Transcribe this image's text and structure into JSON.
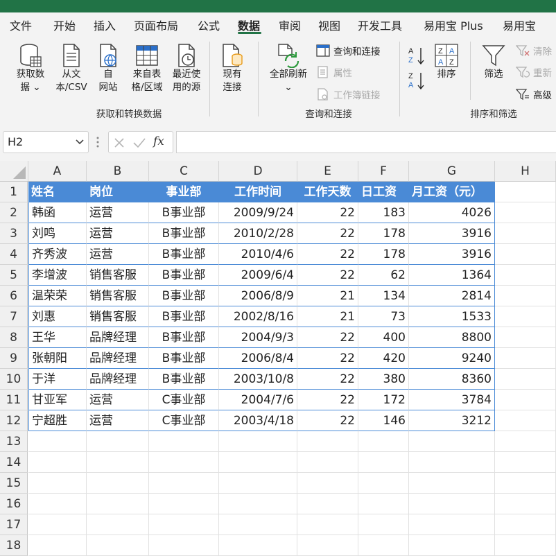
{
  "ribbon_tabs": [
    "文件",
    "开始",
    "插入",
    "页面布局",
    "公式",
    "数据",
    "审阅",
    "视图",
    "开发工具",
    "易用宝 Plus",
    "易用宝"
  ],
  "active_tab": "数据",
  "ribbon": {
    "get_data": {
      "line1": "获取数",
      "line2": "据 ⌄"
    },
    "from_text": {
      "line1": "从文",
      "line2": "本/CSV"
    },
    "from_web": {
      "line1": "自",
      "line2": "网站"
    },
    "from_table": {
      "line1": "来自表",
      "line2": "格/区域"
    },
    "recent_sources": {
      "line1": "最近使",
      "line2": "用的源"
    },
    "existing_conn": {
      "line1": "现有",
      "line2": "连接"
    },
    "refresh_all": {
      "line1": "全部刷新",
      "line2": "⌄"
    },
    "queries_conn": "查询和连接",
    "properties": "属性",
    "edit_links": "工作簿链接",
    "sort": "排序",
    "filter": "筛选",
    "clear": "清除",
    "reapply": "重新",
    "advanced": "高级",
    "group_get_transform": "获取和转换数据",
    "group_queries": "查询和连接",
    "group_sort_filter": "排序和筛选"
  },
  "formula_bar": {
    "name_box": "H2",
    "fx": "fx",
    "formula": ""
  },
  "columns": [
    "A",
    "B",
    "C",
    "D",
    "E",
    "F",
    "G",
    "H"
  ],
  "rows": [
    "1",
    "2",
    "3",
    "4",
    "5",
    "6",
    "7",
    "8",
    "9",
    "10",
    "11",
    "12",
    "13",
    "14",
    "15",
    "16",
    "17",
    "18"
  ],
  "table": {
    "headers": [
      "姓名",
      "岗位",
      "事业部",
      "工作时间",
      "工作天数",
      "日工资",
      "月工资（元）"
    ],
    "data": [
      [
        "韩函",
        "运营",
        "B事业部",
        "2009/9/24",
        "22",
        "183",
        "4026"
      ],
      [
        "刘鸣",
        "运营",
        "B事业部",
        "2010/2/28",
        "22",
        "178",
        "3916"
      ],
      [
        "齐秀波",
        "运营",
        "B事业部",
        "2010/4/6",
        "22",
        "178",
        "3916"
      ],
      [
        "李增波",
        "销售客服",
        "B事业部",
        "2009/6/4",
        "22",
        "62",
        "1364"
      ],
      [
        "温荣荣",
        "销售客服",
        "B事业部",
        "2006/8/9",
        "21",
        "134",
        "2814"
      ],
      [
        "刘惠",
        "销售客服",
        "B事业部",
        "2002/8/16",
        "21",
        "73",
        "1533"
      ],
      [
        "王华",
        "品牌经理",
        "B事业部",
        "2004/9/3",
        "22",
        "400",
        "8800"
      ],
      [
        "张朝阳",
        "品牌经理",
        "B事业部",
        "2006/8/4",
        "22",
        "420",
        "9240"
      ],
      [
        "于洋",
        "品牌经理",
        "B事业部",
        "2003/10/8",
        "22",
        "380",
        "8360"
      ],
      [
        "甘亚军",
        "运营",
        "C事业部",
        "2004/7/6",
        "22",
        "172",
        "3784"
      ],
      [
        "宁超胜",
        "运营",
        "C事业部",
        "2003/4/18",
        "22",
        "146",
        "3212"
      ]
    ]
  },
  "colors": {
    "accent": "#217346",
    "header_fill": "#4a8ad6",
    "border_blue": "#4a8ad6"
  }
}
